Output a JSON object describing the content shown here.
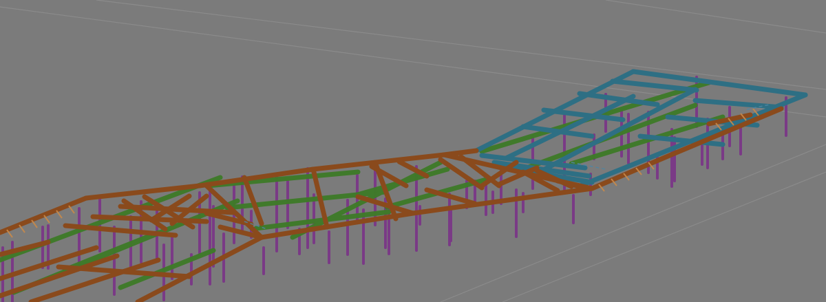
{
  "viewport": {
    "name": "3d-structural-steel-model-view",
    "background": "#7a7a7a"
  },
  "legend_colors": {
    "brown_beams": "#8a4a1c",
    "green_beams": "#3f7a2a",
    "teal_beams": "#2e6f84",
    "purple_columns": "#7a3a86",
    "light_stroke": "#c98a4a"
  }
}
